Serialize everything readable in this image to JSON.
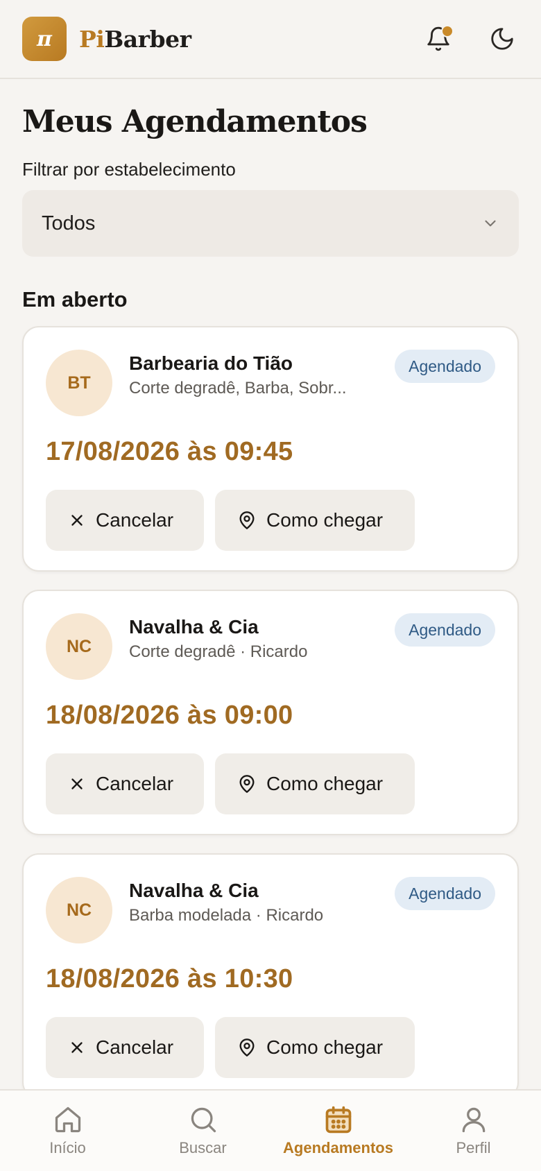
{
  "header": {
    "logo_symbol": "π",
    "brand_part1": "Pi",
    "brand_part2": "Barber",
    "notification_icon": "bell-icon",
    "theme_icon": "moon-icon",
    "accent_color": "#b87a22"
  },
  "page": {
    "title": "Meus Agendamentos",
    "filter_label": "Filtrar por estabelecimento",
    "filter_value": "Todos",
    "section_title": "Em aberto"
  },
  "appointments": [
    {
      "initials": "BT",
      "name": "Barbearia do Tião",
      "details": "Corte degradê, Barba, Sobr...",
      "status": "Agendado",
      "datetime": "17/08/2026 às 09:45",
      "cancel_label": "Cancelar",
      "route_label": "Como chegar"
    },
    {
      "initials": "NC",
      "name": "Navalha & Cia",
      "details": "Corte degradê · Ricardo",
      "status": "Agendado",
      "datetime": "18/08/2026 às 09:00",
      "cancel_label": "Cancelar",
      "route_label": "Como chegar"
    },
    {
      "initials": "NC",
      "name": "Navalha & Cia",
      "details": "Barba modelada · Ricardo",
      "status": "Agendado",
      "datetime": "18/08/2026 às 10:30",
      "cancel_label": "Cancelar",
      "route_label": "Como chegar"
    }
  ],
  "nav": {
    "items": [
      {
        "label": "Início",
        "icon": "home-icon",
        "active": false
      },
      {
        "label": "Buscar",
        "icon": "search-icon",
        "active": false
      },
      {
        "label": "Agendamentos",
        "icon": "calendar-icon",
        "active": true
      },
      {
        "label": "Perfil",
        "icon": "user-icon",
        "active": false
      }
    ]
  }
}
